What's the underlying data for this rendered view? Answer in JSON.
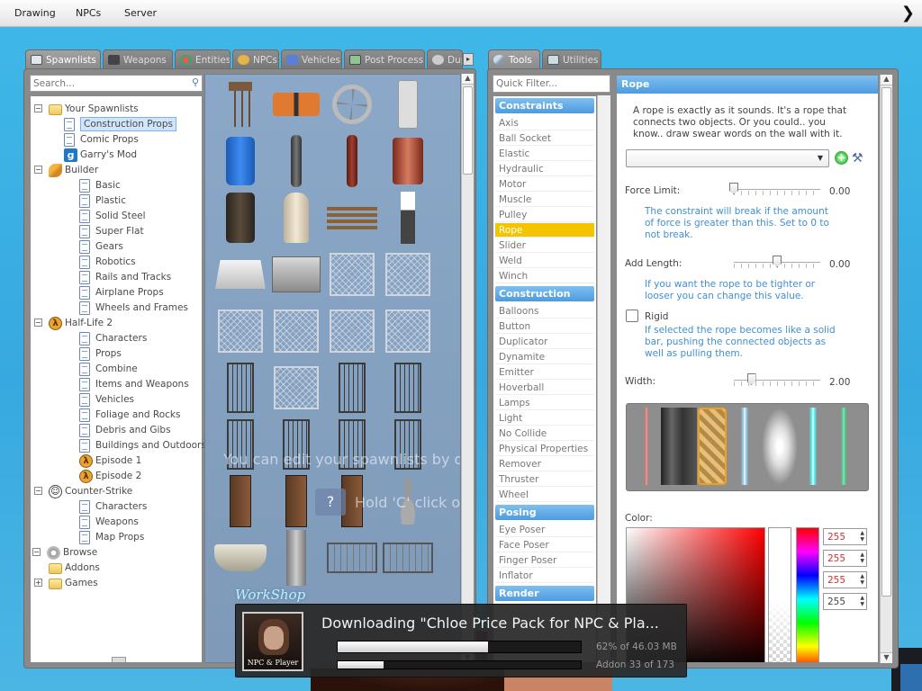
{
  "menubar": {
    "items": [
      "Drawing",
      "NPCs",
      "Server"
    ],
    "right_icon": "chevron-right-icon"
  },
  "spawn_panel": {
    "tabs": [
      {
        "label": "Spawnlists",
        "icon": "grid-icon",
        "active": true
      },
      {
        "label": "Weapons",
        "icon": "gun-icon",
        "active": false
      },
      {
        "label": "Entities",
        "icon": "ball-icon",
        "active": false
      },
      {
        "label": "NPCs",
        "icon": "face-icon",
        "active": false
      },
      {
        "label": "Vehicles",
        "icon": "car-icon",
        "active": false
      },
      {
        "label": "Post Process",
        "icon": "image-icon",
        "active": false
      },
      {
        "label": "Dup",
        "icon": "dupe-icon",
        "active": false
      }
    ],
    "search_placeholder": "Search...",
    "tree": [
      {
        "label": "Your Spawnlists",
        "icon": "folder",
        "depth": 0,
        "expander": "-"
      },
      {
        "label": "Construction Props",
        "icon": "doc",
        "depth": 1,
        "selected": true
      },
      {
        "label": "Comic Props",
        "icon": "doc",
        "depth": 1
      },
      {
        "label": "Garry's Mod",
        "icon": "g",
        "depth": 1
      },
      {
        "label": "Builder",
        "icon": "wrench",
        "depth": 0,
        "expander": "-"
      },
      {
        "label": "Basic",
        "icon": "doc",
        "depth": 2
      },
      {
        "label": "Plastic",
        "icon": "doc",
        "depth": 2
      },
      {
        "label": "Solid Steel",
        "icon": "doc",
        "depth": 2
      },
      {
        "label": "Super Flat",
        "icon": "doc",
        "depth": 2
      },
      {
        "label": "Gears",
        "icon": "doc",
        "depth": 2
      },
      {
        "label": "Robotics",
        "icon": "doc",
        "depth": 2
      },
      {
        "label": "Rails and Tracks",
        "icon": "doc",
        "depth": 2
      },
      {
        "label": "Airplane Props",
        "icon": "doc",
        "depth": 2
      },
      {
        "label": "Wheels and Frames",
        "icon": "doc",
        "depth": 2
      },
      {
        "label": "Half-Life 2",
        "icon": "lambda",
        "depth": 0,
        "expander": "-"
      },
      {
        "label": "Characters",
        "icon": "doc",
        "depth": 2
      },
      {
        "label": "Props",
        "icon": "doc",
        "depth": 2
      },
      {
        "label": "Combine",
        "icon": "doc",
        "depth": 2
      },
      {
        "label": "Items and Weapons",
        "icon": "doc",
        "depth": 2
      },
      {
        "label": "Vehicles",
        "icon": "doc",
        "depth": 2
      },
      {
        "label": "Foliage and Rocks",
        "icon": "doc",
        "depth": 2
      },
      {
        "label": "Debris and Gibs",
        "icon": "doc",
        "depth": 2
      },
      {
        "label": "Buildings and Outdoors",
        "icon": "doc",
        "depth": 2
      },
      {
        "label": "Episode 1",
        "icon": "lambda",
        "depth": 2
      },
      {
        "label": "Episode 2",
        "icon": "lambda",
        "depth": 2
      },
      {
        "label": "Counter-Strike",
        "icon": "cs",
        "depth": 0,
        "expander": "-"
      },
      {
        "label": "Characters",
        "icon": "doc",
        "depth": 2
      },
      {
        "label": "Weapons",
        "icon": "doc",
        "depth": 2
      },
      {
        "label": "Map Props",
        "icon": "doc",
        "depth": 2
      },
      {
        "label": "Browse",
        "icon": "gear",
        "depth": -1,
        "expander": "-"
      },
      {
        "label": "Addons",
        "icon": "folder",
        "depth": 0
      },
      {
        "label": "Games",
        "icon": "folder",
        "depth": 0,
        "expander": "+"
      }
    ],
    "hint_1": "You can edit your spawnlists by drag",
    "hint_2_key": "?",
    "hint_2": "Hold 'C' click on"
  },
  "tool_panel": {
    "tabs": [
      {
        "label": "Tools",
        "icon": "wrench-icon",
        "active": true
      },
      {
        "label": "Utilities",
        "icon": "utilities-icon",
        "active": false
      }
    ],
    "filter_placeholder": "Quick Filter...",
    "categories": [
      {
        "name": "Constraints",
        "items": [
          "Axis",
          "Ball Socket",
          "Elastic",
          "Hydraulic",
          "Motor",
          "Muscle",
          "Pulley",
          "Rope",
          "Slider",
          "Weld",
          "Winch"
        ]
      },
      {
        "name": "Construction",
        "items": [
          "Balloons",
          "Button",
          "Duplicator",
          "Dynamite",
          "Emitter",
          "Hoverball",
          "Lamps",
          "Light",
          "No Collide",
          "Physical Properties",
          "Remover",
          "Thruster",
          "Wheel"
        ]
      },
      {
        "name": "Posing",
        "items": [
          "Eye Poser",
          "Face Poser",
          "Finger Poser",
          "Inflator"
        ]
      },
      {
        "name": "Render",
        "items": []
      }
    ],
    "selected_tool": "Rope"
  },
  "rope": {
    "title": "Rope",
    "description": "A rope is exactly as it sounds. It's a rope that connects two objects. Or you could.. you know.. draw swear words on the wall with it.",
    "combo_value": "",
    "force_limit_label": "Force Limit:",
    "force_limit_value": "0.00",
    "force_limit_fraction": 0.0,
    "force_limit_help": "The constraint will break if the amount of force is greater than this. Set to 0 to not break.",
    "add_length_label": "Add Length:",
    "add_length_value": "0.00",
    "add_length_fraction": 0.5,
    "add_length_help": "If you want the rope to be tighter or looser you can change this value.",
    "rigid_label": "Rigid",
    "rigid_checked": false,
    "rigid_help": "If selected the rope becomes like a solid bar, pushing the connected objects as well as pulling them.",
    "width_label": "Width:",
    "width_value": "2.00",
    "width_fraction": 0.1,
    "color_label": "Color:",
    "color_rgba": [
      "255",
      "255",
      "255",
      "255"
    ],
    "materials": [
      "laser-red",
      "metal-bar",
      "rope-braid",
      "lightning-blue",
      "glow-white",
      "electric-cyan",
      "green-beam"
    ],
    "selected_material": "rope-braid"
  },
  "download": {
    "workshop_label": "WorkShop",
    "title": "Downloading \"Chloe Price Pack for NPC & Pla...",
    "thumb_caption": "NPC & Player",
    "progress_text": "62% of 46.03 MB",
    "progress_fraction": 0.62,
    "addon_text": "Addon 33 of 173",
    "addon_fraction": 0.19
  },
  "colors": {
    "accent_blue": "#4d9be0",
    "selected_tool": "#f5c400",
    "help_text": "#3f8fd6"
  }
}
